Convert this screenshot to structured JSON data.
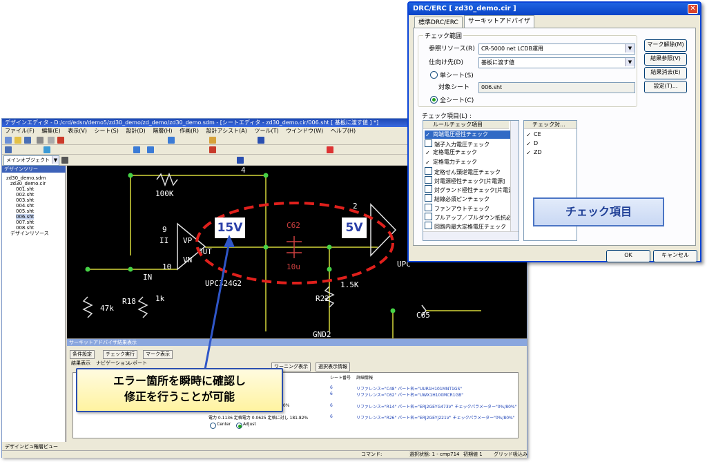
{
  "drc": {
    "title": "DRC/ERC [ zd30_demo.cir ]",
    "close": "✕",
    "tabs": [
      "標準DRC/ERC",
      "サーキットアドバイザ"
    ],
    "group_label": "チェック範囲",
    "ref_resource_label": "参照リソース(R)",
    "ref_resource_value": "CR-5000 net LCDB運用",
    "dest_label": "仕向け先(D)",
    "dest_value": "基板に渡す値",
    "single_sheet_label": "単シート(S)",
    "target_sheet_label": "対象シート",
    "target_sheet_value": "006.sht",
    "all_sheet_label": "全シート(C)",
    "check_items_label": "チェック項目(L) :",
    "rule_header": "ルールチェック項目",
    "rules": [
      {
        "label": "両端電圧極性チェック",
        "checked": true
      },
      {
        "label": "端子入力電圧チェック",
        "checked": false
      },
      {
        "label": "定格電圧チェック",
        "checked": true
      },
      {
        "label": "定格電力チェック",
        "checked": true
      },
      {
        "label": "定格せん頭逆電圧チェック",
        "checked": false
      },
      {
        "label": "対電源極性チェック[片電源]",
        "checked": false
      },
      {
        "label": "対グランド極性チェック[片電源]",
        "checked": false
      },
      {
        "label": "結線必須ピンチェック",
        "checked": false
      },
      {
        "label": "ファンアウトチェック",
        "checked": false
      },
      {
        "label": "プルアップ／プルダウン抵抗必須",
        "checked": false
      },
      {
        "label": "回路内最大定格電圧チェック",
        "checked": false
      }
    ],
    "target_header": "チェック対...",
    "targets": [
      "CE",
      "D",
      "ZD"
    ],
    "buttons": [
      "マーク解除(M)",
      "結果参照(V)",
      "結果消去(E)",
      "設定(T)..."
    ],
    "ok": "OK",
    "cancel": "キャンセル",
    "callout": "チェック項目"
  },
  "editor": {
    "title": "デザインエディタ - D:/crd/edsn/demo5/zd30_demo/zd_demo/zd30_demo.sdm - [シートエディタ - zd30_demo.cir/006.sht [ 基板に渡す値 ] *]",
    "menu": [
      "ファイル(F)",
      "編集(E)",
      "表示(V)",
      "シート(S)",
      "設計(D)",
      "階層(H)",
      "作画(R)",
      "設計アシスト(A)",
      "ツール(T)",
      "ウインドウ(W)",
      "ヘルプ(H)"
    ],
    "object_select": "メインオブジェクト",
    "tree_title": "デザインツリー",
    "tree": [
      "zd30_demo.sdm",
      "zd30_demo.cir",
      "001.sht",
      "002.sht",
      "003.sht",
      "004.sht",
      "005.sht",
      "006.sht",
      "007.sht",
      "008.sht",
      "デザインリソース"
    ],
    "bottom_tabs": [
      "デザインビュー",
      "階層ビュー"
    ],
    "status": [
      "コマンド:",
      "選択状態: 1 - cmp714",
      "初期値 1",
      "グリッド吸込み"
    ]
  },
  "schematic": {
    "label_15v": "15V",
    "label_5v": "5V",
    "parts": [
      "100K",
      "UPC324G2",
      "C62",
      "10u",
      "R22",
      "1.5K",
      "R18",
      "1k",
      "47k",
      "GND2",
      "C65",
      "VP",
      "VN",
      "OUT",
      "IN",
      "II",
      "9",
      "10",
      "2",
      "4",
      "UPC"
    ]
  },
  "result_panel": {
    "title": "サーキットアドバイザ結果表示",
    "buttons": [
      "条件設定",
      "チェック実行",
      "マーク表示"
    ],
    "tabs": [
      "結果表示",
      "ナビゲーション",
      "レポート"
    ],
    "sub_buttons": [
      "ワーニング表示",
      "選択表示情報"
    ],
    "headers": [
      "シート番号",
      "詳細情報"
    ],
    "rows": [
      {
        "sheet": "6",
        "detail": "リファレンス=\"C48\" パート名=\"UUR1H101MNT1GS\""
      },
      {
        "sheet": "6",
        "detail": "リファレンス=\"C62\" パート名=\"UWX1H100MCR1GB\""
      },
      {
        "sheet": "6",
        "detail": "リファレンス=\"R14\" パート名=\"ERJ2GEYG473V\" チェックパラメーター\"0%/80%\""
      },
      {
        "sheet": "6",
        "detail": "リファレンス=\"R26\" パート名=\"ERJ2GEYJ221V\" チェックパラメーター\"0%/80%\""
      }
    ],
    "footer_row": "電力 0.1136 定格電力 0.0625 定格に対し 181.82%",
    "footer_extra": "00%",
    "radio_center": "Center",
    "radio_adjust": "Adjust",
    "callout_line1": "エラー箇所を瞬時に確認し",
    "callout_line2": "修正を行うことが可能"
  }
}
